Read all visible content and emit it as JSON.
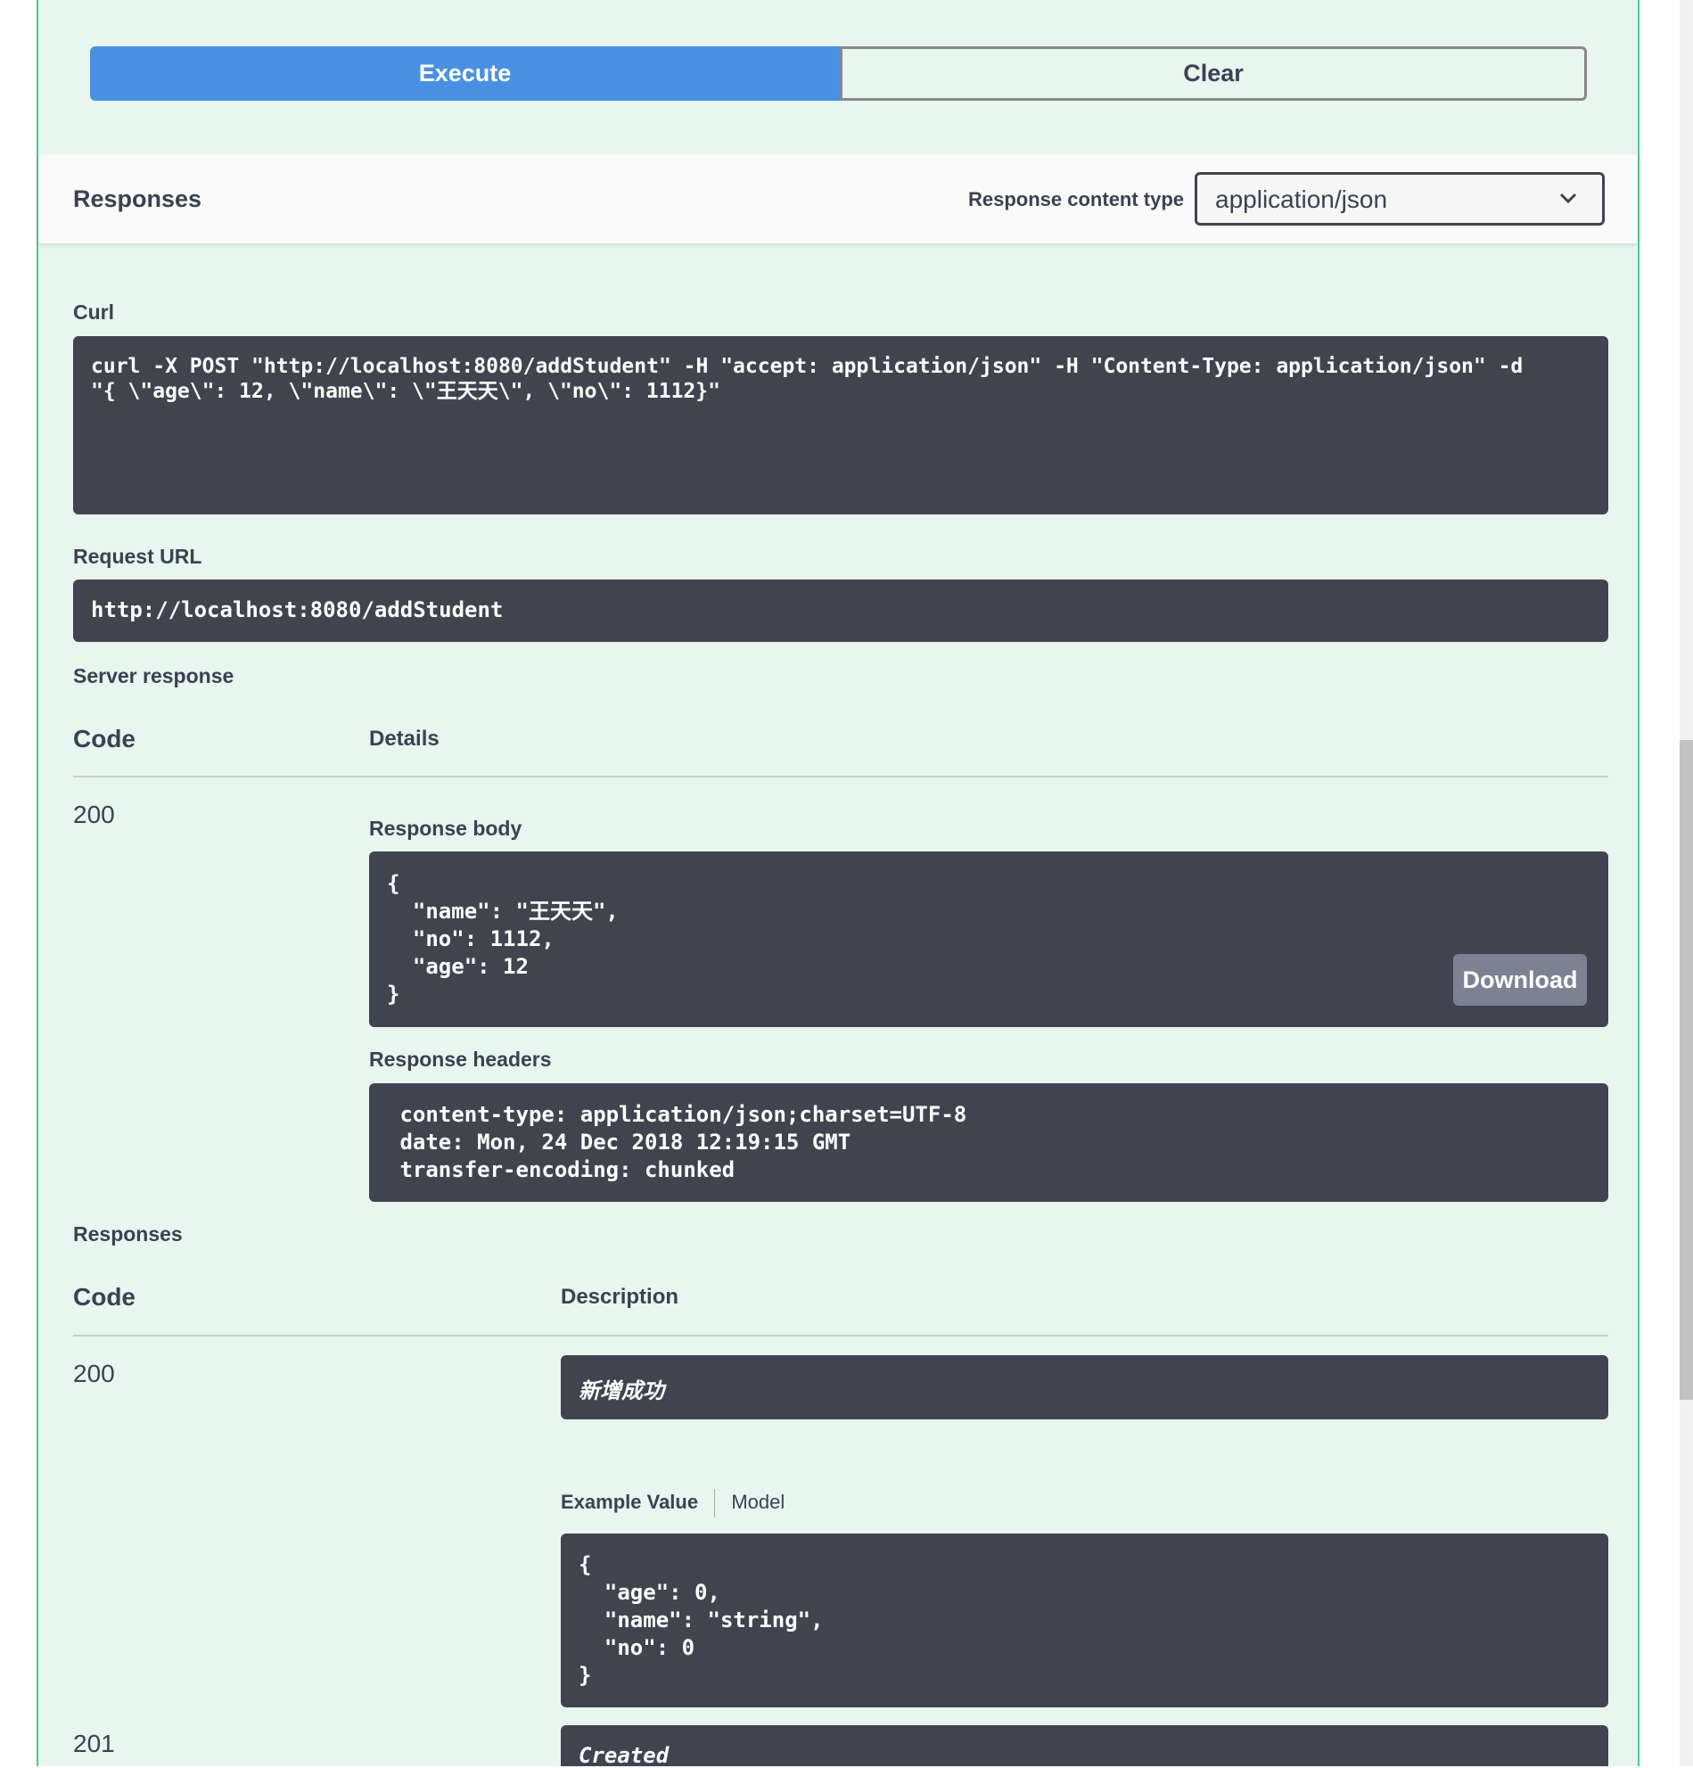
{
  "buttons": {
    "execute": "Execute",
    "clear": "Clear"
  },
  "responses_header": {
    "title": "Responses",
    "content_type_label": "Response content type",
    "content_type_value": "application/json"
  },
  "curl": {
    "label": "Curl",
    "line1": "curl -X POST \"http://localhost:8080/addStudent\" -H \"accept: application/json\" -H \"Content-Type: application/json\" -d",
    "line2": "\"{ \\\"age\\\": 12, \\\"name\\\": \\\"王天天\\\", \\\"no\\\": 1112}\""
  },
  "request_url": {
    "label": "Request URL",
    "value": "http://localhost:8080/addStudent"
  },
  "server_response": {
    "label": "Server response",
    "code_header": "Code",
    "details_header": "Details",
    "code": "200",
    "body_label": "Response body",
    "body_lines": [
      "{",
      "  \"name\": \"王天天\",",
      "  \"no\": 1112,",
      "  \"age\": 12",
      "}"
    ],
    "download": "Download",
    "headers_label": "Response headers",
    "headers_lines": [
      " content-type: application/json;charset=UTF-8",
      " date: Mon, 24 Dec 2018 12:19:15 GMT",
      " transfer-encoding: chunked"
    ]
  },
  "responses": {
    "label": "Responses",
    "code_header": "Code",
    "description_header": "Description",
    "items": [
      {
        "code": "200",
        "description": "新增成功"
      },
      {
        "code": "201",
        "description": "Created"
      }
    ],
    "tabs": {
      "example": "Example Value",
      "model": "Model"
    },
    "example_lines": [
      "{",
      "  \"age\": 0,",
      "  \"name\": \"string\",",
      "  \"no\": 0",
      "}"
    ]
  }
}
